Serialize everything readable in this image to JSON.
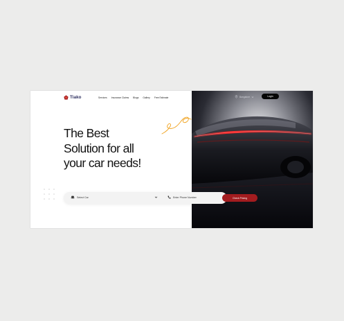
{
  "brand": {
    "name": "Tiako",
    "accent": "#a31c1f",
    "text_color": "#2b2d5e"
  },
  "nav": {
    "items": [
      "Services",
      "Insurance Claims",
      "Blogs",
      "Gallery",
      "Free Estimate"
    ]
  },
  "header_right": {
    "location": "Bangalore",
    "login_label": "Login"
  },
  "hero": {
    "headline_lines": [
      "The Best",
      "Solution for all",
      "your car needs!"
    ]
  },
  "search": {
    "car_select_label": "Select Car",
    "phone_placeholder": "Enter Phone Number",
    "cta_label": "Check Pricing"
  },
  "icons": {
    "logo": "tiako-logo-icon",
    "car": "car-icon",
    "chevron": "chevron-down-icon",
    "phone": "phone-icon",
    "location": "location-pin-icon",
    "location_chevron": "chevron-down-icon"
  }
}
